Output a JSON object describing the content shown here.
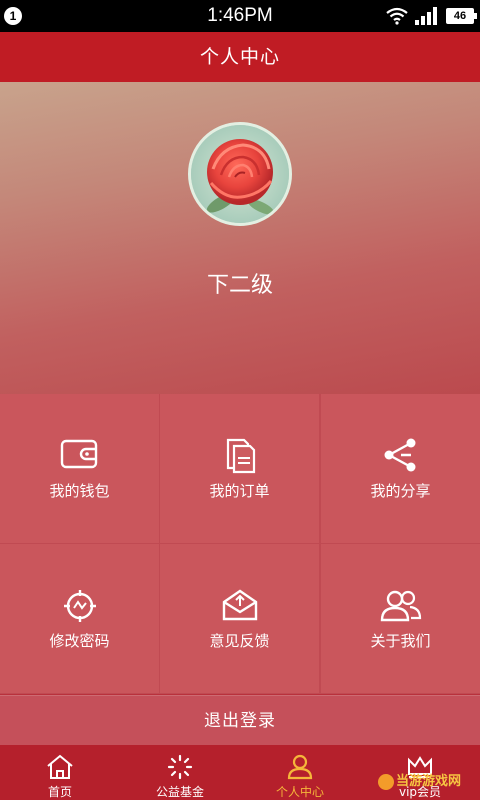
{
  "status_bar": {
    "notification_count": "1",
    "time": "1:46PM",
    "battery": "46"
  },
  "title": "个人中心",
  "profile": {
    "username": "下二级"
  },
  "menu": [
    {
      "label": "我的钱包",
      "icon": "wallet-icon"
    },
    {
      "label": "我的订单",
      "icon": "document-icon"
    },
    {
      "label": "我的分享",
      "icon": "share-icon"
    },
    {
      "label": "修改密码",
      "icon": "password-icon"
    },
    {
      "label": "意见反馈",
      "icon": "mail-icon"
    },
    {
      "label": "关于我们",
      "icon": "users-icon"
    }
  ],
  "logout_label": "退出登录",
  "bottom_nav": [
    {
      "label": "首页",
      "icon": "home-icon",
      "active": false
    },
    {
      "label": "公益基金",
      "icon": "loading-icon",
      "active": false
    },
    {
      "label": "个人中心",
      "icon": "person-icon",
      "active": true
    },
    {
      "label": "vip会员",
      "icon": "crown-icon",
      "active": false
    }
  ],
  "watermark": "当游游戏网",
  "colors": {
    "title_bar": "#c01c24",
    "active_tab": "#f5b63a",
    "nav_bar": "#b5202c"
  }
}
